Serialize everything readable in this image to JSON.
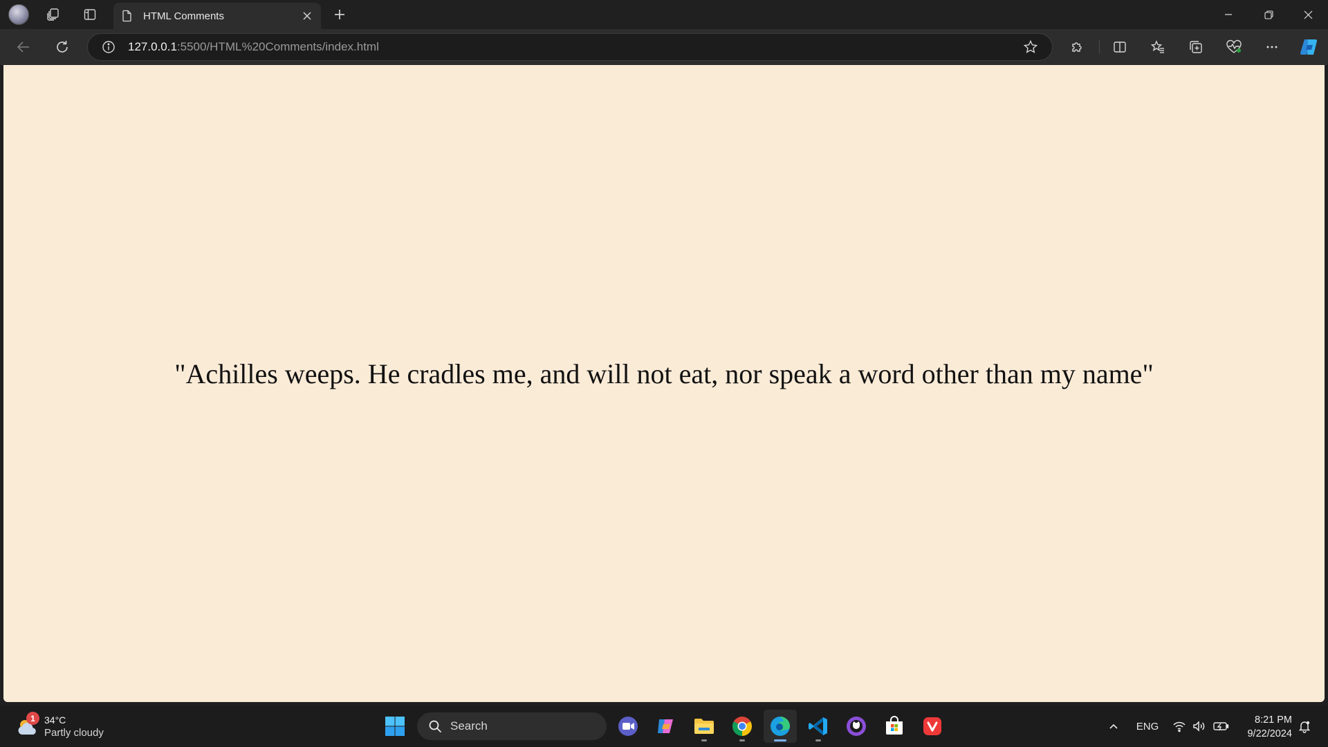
{
  "browser": {
    "tab": {
      "title": "HTML Comments"
    },
    "address": {
      "host": "127.0.0.1",
      "rest": ":5500/HTML%20Comments/index.html"
    }
  },
  "page": {
    "background_color": "#faebd7",
    "quote": "\"Achilles weeps. He cradles me, and will not eat, nor speak a word other than my name\""
  },
  "taskbar": {
    "weather": {
      "badge": "1",
      "temperature": "34°C",
      "condition": "Partly cloudy"
    },
    "search_label": "Search",
    "apps": [
      "meet-now",
      "copilot",
      "file-explorer",
      "chrome",
      "edge",
      "vscode",
      "github-desktop",
      "microsoft-store",
      "vivaldi"
    ],
    "tray": {
      "language": "ENG",
      "time": "8:21 PM",
      "date": "9/22/2024"
    }
  }
}
